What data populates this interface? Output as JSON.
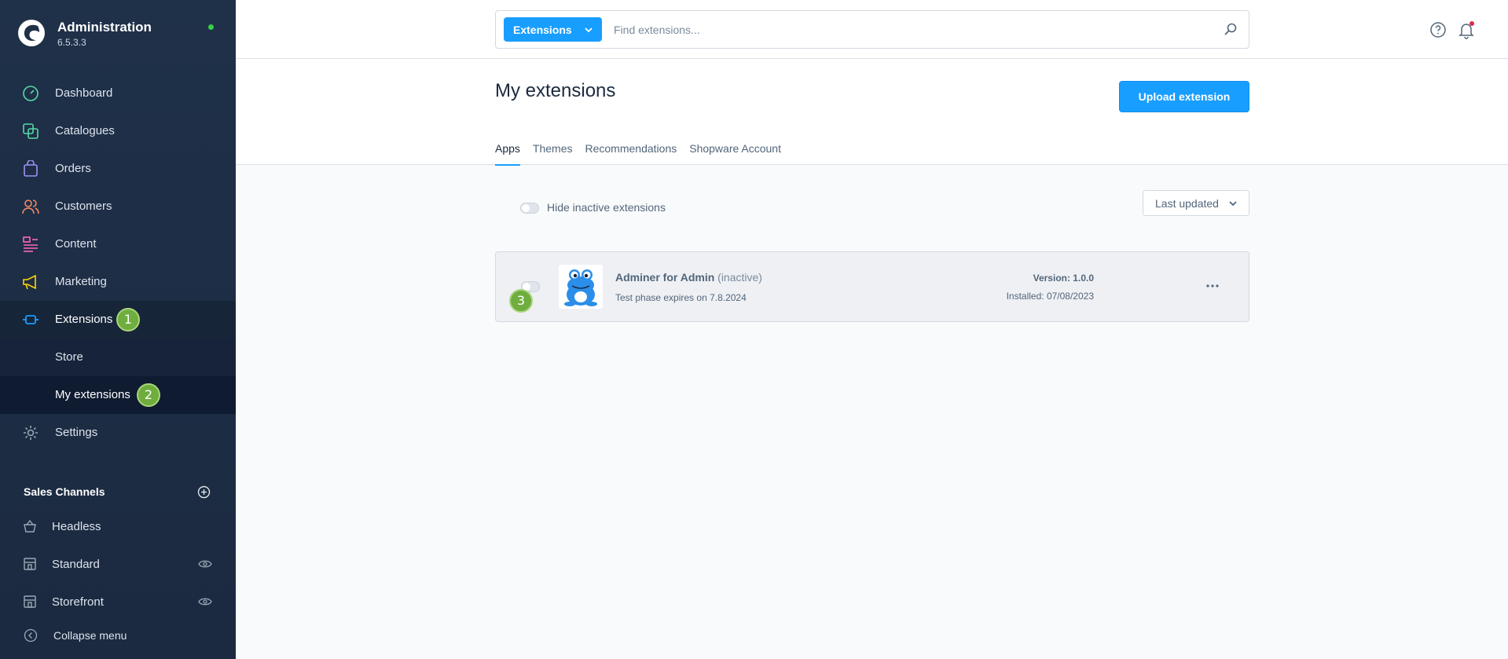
{
  "app": {
    "title": "Administration",
    "version": "6.5.3.3"
  },
  "sidebar": {
    "items": [
      {
        "label": "Dashboard",
        "icon": "dashboard-icon",
        "color": "#57d9a3"
      },
      {
        "label": "Catalogues",
        "icon": "catalogue-icon",
        "color": "#57d9a3"
      },
      {
        "label": "Orders",
        "icon": "orders-icon",
        "color": "#a092f0"
      },
      {
        "label": "Customers",
        "icon": "customers-icon",
        "color": "#f88962"
      },
      {
        "label": "Content",
        "icon": "content-icon",
        "color": "#ff68b4"
      },
      {
        "label": "Marketing",
        "icon": "marketing-icon",
        "color": "#ffd700"
      },
      {
        "label": "Extensions",
        "icon": "extensions-icon",
        "color": "#189eff"
      },
      {
        "label": "Settings",
        "icon": "settings-icon",
        "color": "#9aa8b5"
      }
    ],
    "extensions_sub": [
      {
        "label": "Store"
      },
      {
        "label": "My extensions"
      }
    ],
    "sales_channels_title": "Sales Channels",
    "sales_channels": [
      {
        "label": "Headless",
        "icon": "basket-icon"
      },
      {
        "label": "Standard",
        "icon": "storefront-icon"
      },
      {
        "label": "Storefront",
        "icon": "storefront-icon"
      }
    ],
    "collapse_label": "Collapse menu"
  },
  "badges": [
    "1",
    "2",
    "3"
  ],
  "search": {
    "type_label": "Extensions",
    "placeholder": "Find extensions..."
  },
  "page": {
    "title": "My extensions",
    "upload_label": "Upload extension",
    "tabs": [
      "Apps",
      "Themes",
      "Recommendations",
      "Shopware Account"
    ]
  },
  "filters": {
    "hide_inactive_label": "Hide inactive extensions",
    "sort_label": "Last updated"
  },
  "extension": {
    "name": "Adminer for Admin",
    "status": "(inactive)",
    "trial": "Test phase expires on 7.8.2024",
    "version": "Version: 1.0.0",
    "installed": "Installed: 07/08/2023"
  },
  "colors": {
    "primary": "#189eff",
    "sidebar": "#1f3049",
    "badge": "#6fad3e"
  }
}
